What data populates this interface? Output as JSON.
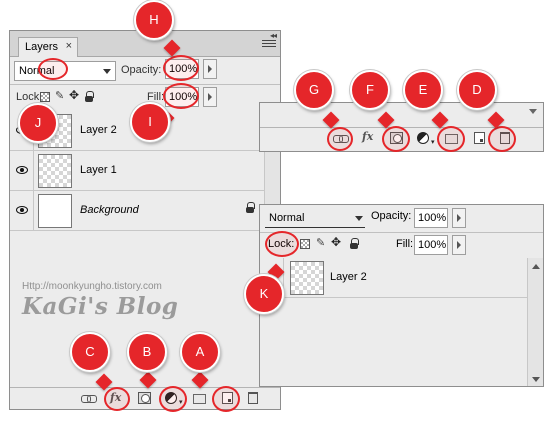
{
  "panel": {
    "tab_label": "Layers",
    "tab_close": "×",
    "blend_mode": "Normal",
    "opacity_label": "Opacity:",
    "opacity_value": "100%",
    "lock_label": "Lock:",
    "fill_label": "Fill:",
    "fill_value": "100%",
    "layers": [
      {
        "name": "Layer 2",
        "visible": true,
        "thumbnail": "checker"
      },
      {
        "name": "Layer 1",
        "visible": true,
        "thumbnail": "checker"
      },
      {
        "name": "Background",
        "visible": true,
        "thumbnail": "white",
        "locked": true
      }
    ],
    "bottom_icons": [
      "link-layers-icon",
      "fx-icon",
      "layer-mask-icon",
      "adjustment-layer-icon",
      "group-folder-icon",
      "new-layer-icon",
      "trash-icon"
    ],
    "fx_text": "fx"
  },
  "watermark": {
    "url": "Http://moonkyungho.tistory.com",
    "blog": "KaGi's Blog"
  },
  "zoom_layers": {
    "blend_mode": "Normal",
    "opacity_label": "Opacity:",
    "opacity_value": "100%",
    "lock_label": "Lock:",
    "fill_label": "Fill:",
    "fill_value": "100%",
    "layer_name": "Layer 2"
  },
  "zoom_tools": {
    "fx_text": "fx"
  },
  "callouts": [
    "A",
    "B",
    "C",
    "D",
    "E",
    "F",
    "G",
    "H",
    "I",
    "J",
    "K"
  ],
  "colors": {
    "callout_red": "#e5262a",
    "panel_bg": "#ececec"
  }
}
